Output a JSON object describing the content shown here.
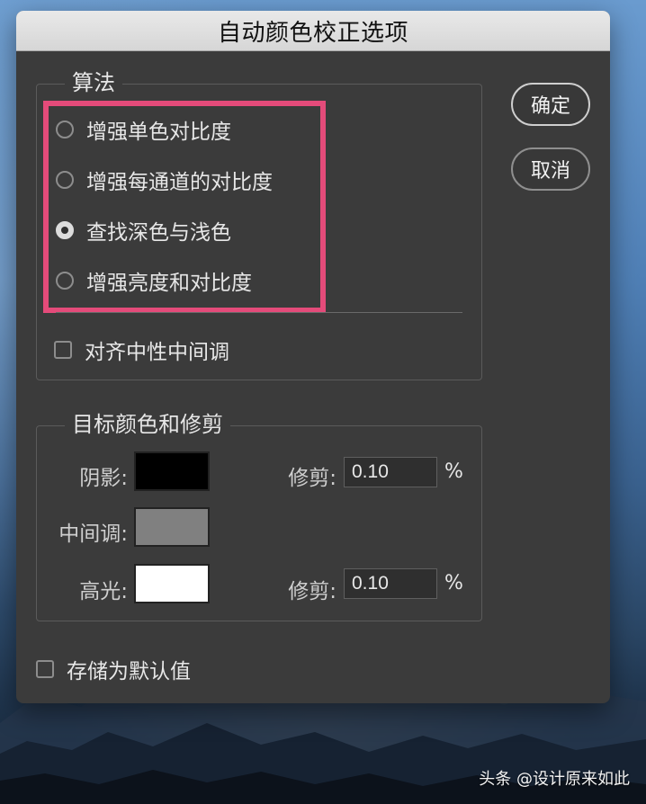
{
  "dialog": {
    "title": "自动颜色校正选项",
    "buttons": {
      "ok": "确定",
      "cancel": "取消"
    }
  },
  "algorithms": {
    "legend": "算法",
    "options": [
      {
        "label": "增强单色对比度",
        "selected": false
      },
      {
        "label": "增强每通道的对比度",
        "selected": false
      },
      {
        "label": "查找深色与浅色",
        "selected": true
      },
      {
        "label": "增强亮度和对比度",
        "selected": false
      }
    ],
    "snap_neutral_midtones_label": "对齐中性中间调",
    "snap_neutral_midtones_checked": false
  },
  "target_colors": {
    "legend": "目标颜色和修剪",
    "shadows": {
      "label": "阴影:",
      "swatch_color": "#000000",
      "clip_label": "修剪:",
      "clip_value": "0.10",
      "clip_unit": "%"
    },
    "midtones": {
      "label": "中间调:",
      "swatch_color": "#808080"
    },
    "highlights": {
      "label": "高光:",
      "swatch_color": "#ffffff",
      "clip_label": "修剪:",
      "clip_value": "0.10",
      "clip_unit": "%"
    }
  },
  "save_as_defaults": {
    "label": "存储为默认值",
    "checked": false
  },
  "watermark": "头条 @设计原来如此",
  "colors": {
    "highlight_box": "#e44b7a"
  }
}
